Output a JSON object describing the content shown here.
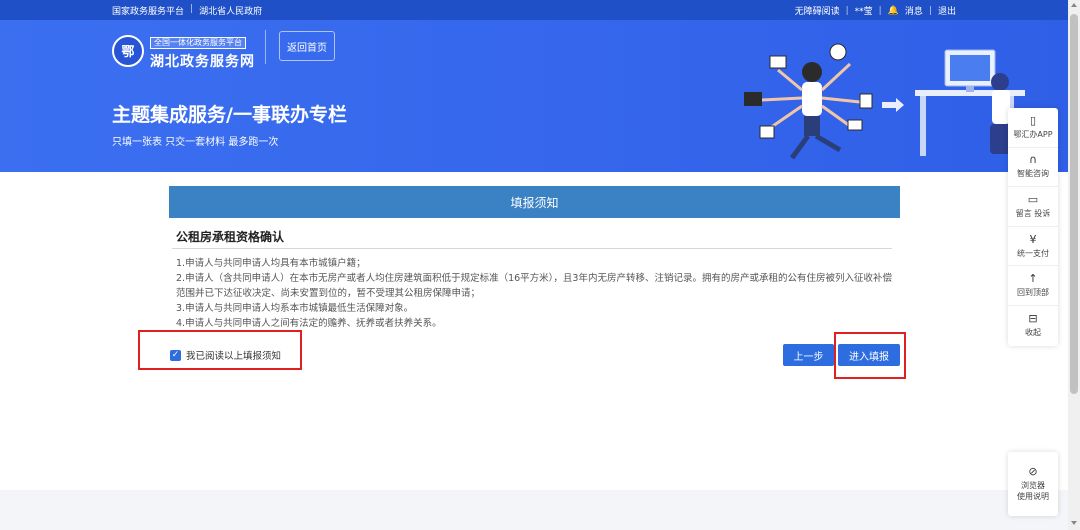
{
  "topbar": {
    "left_links": [
      "国家政务服务平台",
      "湖北省人民政府"
    ],
    "accessibility": "无障碍阅读",
    "user": "**莹",
    "messages": "消息",
    "logout": "退出"
  },
  "logo": {
    "tag": "全国一体化政务服务平台",
    "title": "湖北政务服务网"
  },
  "home_button": "返回首页",
  "hero": {
    "title": "主题集成服务/一事联办专栏",
    "subtitle": "只填一张表 只交一套材料 最多跑一次"
  },
  "notice": {
    "header": "填报须知",
    "title": "公租房承租资格确认",
    "items": [
      "1.申请人与共同申请人均具有本市城镇户籍；",
      "2.申请人（含共同申请人）在本市无房产或者人均住房建筑面积低于规定标准（16平方米），且3年内无房产转移、注销记录。拥有的房产或承租的公有住房被列入征收补偿范围并已下达征收决定、尚未安置到位的，暂不受理其公租房保障申请；",
      "3.申请人与共同申请人均系本市城镇最低生活保障对象。",
      "4.申请人与共同申请人之间有法定的赡养、抚养或者扶养关系。"
    ],
    "agree_label": "我已阅读以上填报须知",
    "agree_checked": true
  },
  "buttons": {
    "prev": "上一步",
    "enter": "进入填报"
  },
  "sidetool": [
    {
      "icon": "phone-icon",
      "label": "鄂汇办APP"
    },
    {
      "icon": "headset-icon",
      "label": "智能咨询"
    },
    {
      "icon": "chat-icon",
      "label": "留言 投诉"
    },
    {
      "icon": "yen-icon",
      "label": "统一支付"
    },
    {
      "icon": "arrow-up-icon",
      "label": "回到顶部"
    },
    {
      "icon": "collapse-icon",
      "label": "收起"
    }
  ],
  "browser_guide": {
    "line1": "浏览器",
    "line2": "使用说明"
  },
  "colors": {
    "brand_blue": "#3566ec",
    "notice_header": "#3a82c4",
    "button": "#2d6de0",
    "highlight": "#e02020"
  }
}
